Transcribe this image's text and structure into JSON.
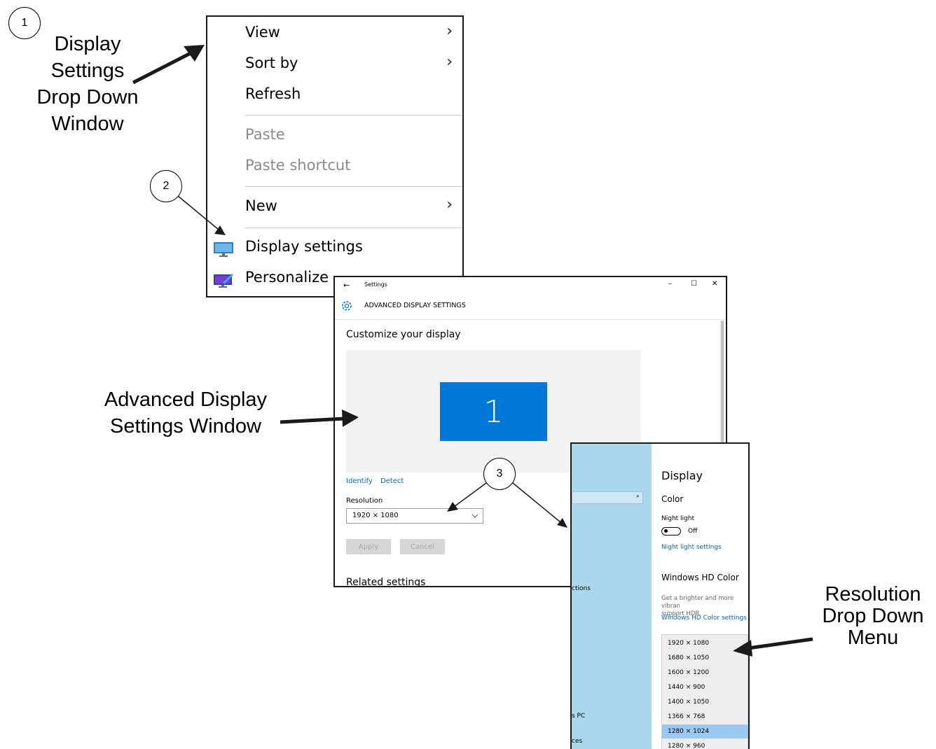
{
  "callouts": {
    "c1": "1",
    "c2": "2",
    "c3": "3"
  },
  "annotations": {
    "display_settings_dropdown": [
      "Display",
      "Settings",
      "Drop Down",
      "Window"
    ],
    "advanced_display_window": [
      "Advanced Display",
      "Settings Window"
    ],
    "resolution_dropdown": [
      "Resolution",
      "Drop Down",
      "Menu"
    ]
  },
  "context_menu": {
    "view": "View",
    "sort_by": "Sort by",
    "refresh": "Refresh",
    "paste": "Paste",
    "paste_shortcut": "Paste shortcut",
    "new": "New",
    "display_settings": "Display settings",
    "personalize": "Personalize",
    "chevron": "›"
  },
  "advanced_window": {
    "app_title": "Settings",
    "back_glyph": "←",
    "window_controls": {
      "minimize": "–",
      "maximize": "☐",
      "close": "✕"
    },
    "page_header": "ADVANCED DISPLAY SETTINGS",
    "customize_heading": "Customize your display",
    "monitor_number": "1",
    "identify_link": "Identify",
    "detect_link": "Detect",
    "resolution_label": "Resolution",
    "resolution_value": "1920 × 1080",
    "apply_button": "Apply",
    "cancel_button": "Cancel",
    "related_settings": "Related settings"
  },
  "display_window": {
    "sidebar_partial_1": "ctions",
    "sidebar_partial_2": "s PC",
    "sidebar_partial_3": "ces",
    "title": "Display",
    "color_heading": "Color",
    "night_light_label": "Night light",
    "night_light_state": "Off",
    "night_light_settings_link": "Night light settings",
    "hd_color_heading": "Windows HD Color",
    "hd_color_desc_1": "Get a brighter and more vibran",
    "hd_color_desc_2": "support HDR.",
    "hd_color_settings_link": "Windows HD Color settings",
    "resolutions": [
      "1920 × 1080",
      "1680 × 1050",
      "1600 × 1200",
      "1440 × 900",
      "1400 × 1050",
      "1366 × 768",
      "1280 × 1024",
      "1280 × 960"
    ],
    "selected_resolution": "1280 × 1024"
  },
  "colors": {
    "accent": "#0078d7",
    "selected": "#99c9f0",
    "sidebar": "#a9d7ee",
    "link": "#0067c0"
  }
}
